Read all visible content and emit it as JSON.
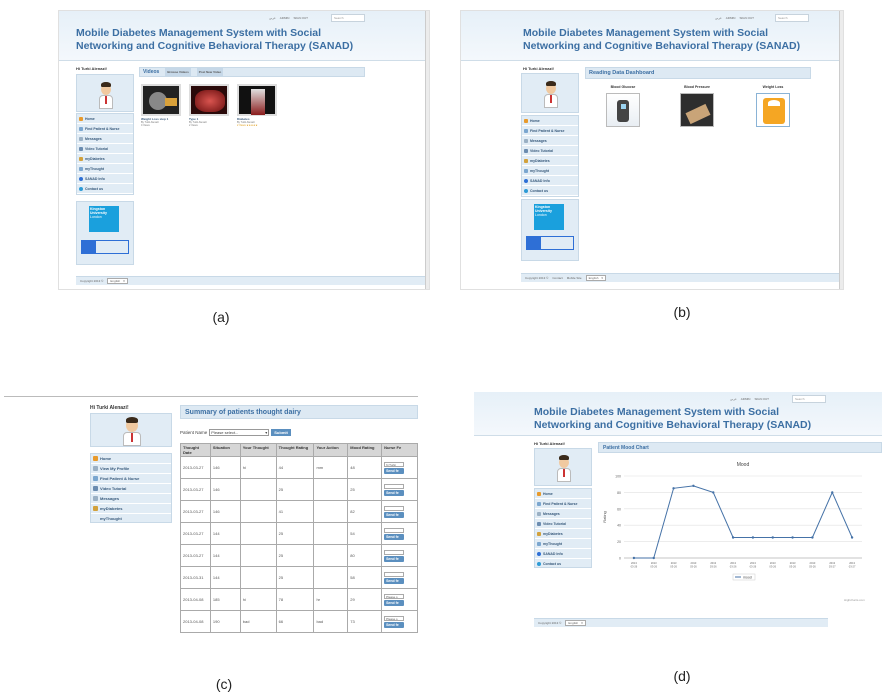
{
  "captions": {
    "a": "(a)",
    "b": "(b)",
    "c": "(c)",
    "d": "(d)"
  },
  "app": {
    "title": "Mobile Diabetes Management System with Social Networking and Cognitive Behavioral Therapy (SANAD)",
    "greeting": "Hi Turki Alenazi!",
    "toplinks": [
      "عربي",
      "ADMIN",
      "SIGN OUT"
    ],
    "search_placeholder": "Search",
    "copyright": "Copyright 2013 ©",
    "language": "English",
    "footer_links_b": [
      "Contact",
      "Mobile Site"
    ],
    "kingston_lines": [
      "Kingston",
      "University",
      "London"
    ]
  },
  "panel_a": {
    "menu": [
      "Home",
      "Find Patient & Nurse",
      "Messages",
      "Video Tutorial",
      "myDiabetes",
      "myThought",
      "SANAD Info",
      "Contact us"
    ],
    "videos_label": "Videos",
    "video_tabs": [
      "Browse Videos",
      "Post New Video"
    ],
    "videos": [
      {
        "title": "Weight Loss step 1",
        "author": "By Turki Alenazi",
        "meta": "0 Views"
      },
      {
        "title": "Type 1",
        "author": "By Turki Alenazi",
        "meta": "2 Views"
      },
      {
        "title": "Diabetes",
        "author": "By Turki Alenazi",
        "meta": "2 Views ★★★★★"
      }
    ]
  },
  "panel_b": {
    "menu": [
      "Home",
      "Find Patient & Nurse",
      "Messages",
      "Video Tutorial",
      "myDiabetes",
      "myThought",
      "SANAD Info",
      "Contact us"
    ],
    "dashboard_title": "Reading Data Dashboard",
    "readings": [
      "Blood Glucose",
      "Blood Pressure",
      "Weight Loss"
    ]
  },
  "panel_c": {
    "menu": [
      "Home",
      "View My Profile",
      "Find Patient & Nurse",
      "Video Tutorial",
      "Messages",
      "myDiabetes",
      "myThought"
    ],
    "section_title": "Summary of patients thought dairy",
    "patient_label": "Patient Name",
    "patient_select": "Please select...",
    "submit_label": "Submit",
    "columns": [
      "Thought Date",
      "Situation",
      "Your Thought",
      "Thought Rating",
      "Your Action",
      "Mood Rating",
      "Nurse Fe"
    ],
    "rows": [
      {
        "date": "2013-03-27",
        "situation": "146",
        "thought": "hi",
        "trating": "44",
        "action": "mm",
        "mood": "48",
        "fb": "hi Turki",
        "btn": "Send fe"
      },
      {
        "date": "2013-03-27",
        "situation": "146",
        "thought": "",
        "trating": "25",
        "action": "",
        "mood": "25",
        "fb": "",
        "btn": "Send fe"
      },
      {
        "date": "2013-03-27",
        "situation": "146",
        "thought": "",
        "trating": "41",
        "action": "",
        "mood": "82",
        "fb": "",
        "btn": "Send fe"
      },
      {
        "date": "2013-03-27",
        "situation": "144",
        "thought": "",
        "trating": "25",
        "action": "",
        "mood": "54",
        "fb": "",
        "btn": "Send fe"
      },
      {
        "date": "2013-03-27",
        "situation": "144",
        "thought": "",
        "trating": "25",
        "action": "",
        "mood": "80",
        "fb": "",
        "btn": "Send fe"
      },
      {
        "date": "2013-03-31",
        "situation": "144",
        "thought": "",
        "trating": "25",
        "action": "",
        "mood": "58",
        "fb": "",
        "btn": "Send fe"
      },
      {
        "date": "2013-04-08",
        "situation": "185",
        "thought": "hi",
        "trating": "78",
        "action": "hr",
        "mood": "29",
        "fb": "Please s",
        "btn": "Send fe"
      },
      {
        "date": "2013-04-08",
        "situation": "190",
        "thought": "bad",
        "trating": "66",
        "action": "bad",
        "mood": "73",
        "fb": "Please s",
        "btn": "Send fe"
      }
    ]
  },
  "panel_d": {
    "menu": [
      "Home",
      "Find Patient & Nurse",
      "Messages",
      "Video Tutorial",
      "myDiabetes",
      "myThought",
      "SANAD Info",
      "Contact us"
    ],
    "chart_section_title": "Patient Mood Chart",
    "credit": "Highcharts.com"
  },
  "chart_data": {
    "type": "line",
    "title": "Mood",
    "ylabel": "Rating",
    "categories": [
      "2013-03-26",
      "2013-03-26",
      "2013-03-26",
      "2013-03-26",
      "2013-03-26",
      "2013-03-26",
      "2013-03-26",
      "2013-03-26",
      "2013-03-26",
      "2013-03-26",
      "2013-03-27",
      "2013-03-27"
    ],
    "series": [
      {
        "name": "mood",
        "values": [
          0,
          0,
          85,
          88,
          80,
          25,
          25,
          25,
          25,
          25,
          80,
          25
        ]
      }
    ],
    "ylim": [
      0,
      100
    ],
    "yticks": [
      0,
      20,
      40,
      60,
      80,
      100
    ],
    "grid": true,
    "legend": "bottom-center",
    "line_color": "#4572a7"
  }
}
